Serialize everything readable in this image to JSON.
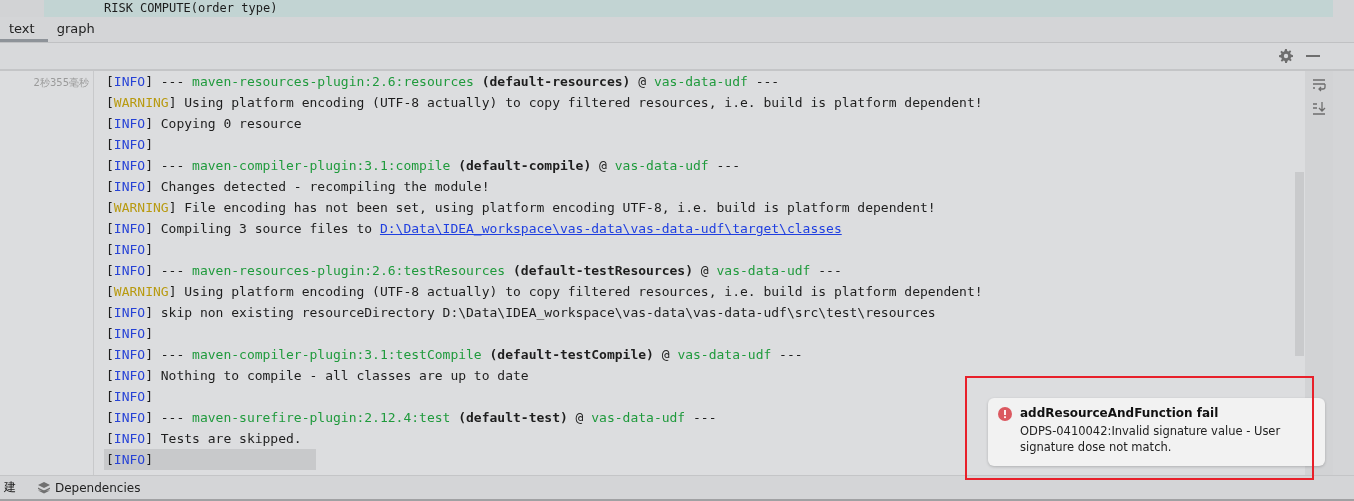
{
  "editor_line": "RISK COMPUTE(order type)",
  "tabs": [
    {
      "label": "text",
      "selected": true
    },
    {
      "label": "graph",
      "selected": false
    }
  ],
  "gutter": {
    "elapsed": "2秒355毫秒"
  },
  "log_lines": [
    [
      {
        "kind": "plain",
        "text": "["
      },
      {
        "kind": "info",
        "text": "INFO"
      },
      {
        "kind": "plain",
        "text": "] --- "
      },
      {
        "kind": "plugin",
        "text": "maven-resources-plugin:2.6:resources"
      },
      {
        "kind": "bold",
        "text": " (default-resources)"
      },
      {
        "kind": "plain",
        "text": " @ "
      },
      {
        "kind": "plugin",
        "text": "vas-data-udf"
      },
      {
        "kind": "plain",
        "text": " ---"
      }
    ],
    [
      {
        "kind": "plain",
        "text": "["
      },
      {
        "kind": "warning",
        "text": "WARNING"
      },
      {
        "kind": "plain",
        "text": "] Using platform encoding (UTF-8 actually) to copy filtered resources, i.e. build is platform dependent!"
      }
    ],
    [
      {
        "kind": "plain",
        "text": "["
      },
      {
        "kind": "info",
        "text": "INFO"
      },
      {
        "kind": "plain",
        "text": "] Copying 0 resource"
      }
    ],
    [
      {
        "kind": "plain",
        "text": "["
      },
      {
        "kind": "info",
        "text": "INFO"
      },
      {
        "kind": "plain",
        "text": "]"
      }
    ],
    [
      {
        "kind": "plain",
        "text": "["
      },
      {
        "kind": "info",
        "text": "INFO"
      },
      {
        "kind": "plain",
        "text": "] --- "
      },
      {
        "kind": "plugin",
        "text": "maven-compiler-plugin:3.1:compile"
      },
      {
        "kind": "bold",
        "text": " (default-compile)"
      },
      {
        "kind": "plain",
        "text": " @ "
      },
      {
        "kind": "plugin",
        "text": "vas-data-udf"
      },
      {
        "kind": "plain",
        "text": " ---"
      }
    ],
    [
      {
        "kind": "plain",
        "text": "["
      },
      {
        "kind": "info",
        "text": "INFO"
      },
      {
        "kind": "plain",
        "text": "] Changes detected - recompiling the module!"
      }
    ],
    [
      {
        "kind": "plain",
        "text": "["
      },
      {
        "kind": "warning",
        "text": "WARNING"
      },
      {
        "kind": "plain",
        "text": "] File encoding has not been set, using platform encoding UTF-8, i.e. build is platform dependent!"
      }
    ],
    [
      {
        "kind": "plain",
        "text": "["
      },
      {
        "kind": "info",
        "text": "INFO"
      },
      {
        "kind": "plain",
        "text": "] Compiling 3 source files to "
      },
      {
        "kind": "link",
        "text": "D:\\Data\\IDEA_workspace\\vas-data\\vas-data-udf\\target\\classes"
      }
    ],
    [
      {
        "kind": "plain",
        "text": "["
      },
      {
        "kind": "info",
        "text": "INFO"
      },
      {
        "kind": "plain",
        "text": "]"
      }
    ],
    [
      {
        "kind": "plain",
        "text": "["
      },
      {
        "kind": "info",
        "text": "INFO"
      },
      {
        "kind": "plain",
        "text": "] --- "
      },
      {
        "kind": "plugin",
        "text": "maven-resources-plugin:2.6:testResources"
      },
      {
        "kind": "bold",
        "text": " (default-testResources)"
      },
      {
        "kind": "plain",
        "text": " @ "
      },
      {
        "kind": "plugin",
        "text": "vas-data-udf"
      },
      {
        "kind": "plain",
        "text": " ---"
      }
    ],
    [
      {
        "kind": "plain",
        "text": "["
      },
      {
        "kind": "warning",
        "text": "WARNING"
      },
      {
        "kind": "plain",
        "text": "] Using platform encoding (UTF-8 actually) to copy filtered resources, i.e. build is platform dependent!"
      }
    ],
    [
      {
        "kind": "plain",
        "text": "["
      },
      {
        "kind": "info",
        "text": "INFO"
      },
      {
        "kind": "plain",
        "text": "] skip non existing resourceDirectory D:\\Data\\IDEA_workspace\\vas-data\\vas-data-udf\\src\\test\\resources"
      }
    ],
    [
      {
        "kind": "plain",
        "text": "["
      },
      {
        "kind": "info",
        "text": "INFO"
      },
      {
        "kind": "plain",
        "text": "]"
      }
    ],
    [
      {
        "kind": "plain",
        "text": "["
      },
      {
        "kind": "info",
        "text": "INFO"
      },
      {
        "kind": "plain",
        "text": "] --- "
      },
      {
        "kind": "plugin",
        "text": "maven-compiler-plugin:3.1:testCompile"
      },
      {
        "kind": "bold",
        "text": " (default-testCompile)"
      },
      {
        "kind": "plain",
        "text": " @ "
      },
      {
        "kind": "plugin",
        "text": "vas-data-udf"
      },
      {
        "kind": "plain",
        "text": " ---"
      }
    ],
    [
      {
        "kind": "plain",
        "text": "["
      },
      {
        "kind": "info",
        "text": "INFO"
      },
      {
        "kind": "plain",
        "text": "] Nothing to compile - all classes are up to date"
      }
    ],
    [
      {
        "kind": "plain",
        "text": "["
      },
      {
        "kind": "info",
        "text": "INFO"
      },
      {
        "kind": "plain",
        "text": "]"
      }
    ],
    [
      {
        "kind": "plain",
        "text": "["
      },
      {
        "kind": "info",
        "text": "INFO"
      },
      {
        "kind": "plain",
        "text": "] --- "
      },
      {
        "kind": "plugin",
        "text": "maven-surefire-plugin:2.12.4:test"
      },
      {
        "kind": "bold",
        "text": " (default-test)"
      },
      {
        "kind": "plain",
        "text": " @ "
      },
      {
        "kind": "plugin",
        "text": "vas-data-udf"
      },
      {
        "kind": "plain",
        "text": " ---"
      }
    ],
    [
      {
        "kind": "plain",
        "text": "["
      },
      {
        "kind": "info",
        "text": "INFO"
      },
      {
        "kind": "plain",
        "text": "] Tests are skipped."
      }
    ],
    [
      {
        "kind": "plain",
        "text": "["
      },
      {
        "kind": "info",
        "text": "INFO"
      },
      {
        "kind": "plain",
        "text": "]"
      }
    ]
  ],
  "notification": {
    "title": "addResourceAndFunction fail",
    "message": "ODPS-0410042:Invalid signature value - User signature dose not match."
  },
  "status_bar": [
    {
      "label": "建",
      "kind": "text"
    },
    {
      "label": "Dependencies",
      "kind": "layers"
    }
  ]
}
